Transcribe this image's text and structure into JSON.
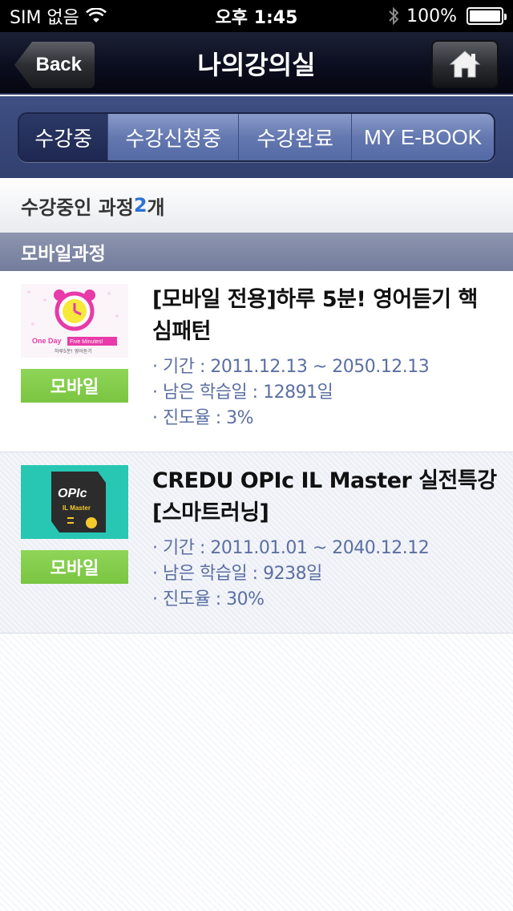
{
  "status_bar": {
    "carrier": "SIM 없음",
    "time": "오후 1:45",
    "battery": "100%"
  },
  "nav": {
    "back_label": "Back",
    "title": "나의강의실"
  },
  "tabs": [
    {
      "label": "수강중",
      "active": true
    },
    {
      "label": "수강신청중",
      "active": false
    },
    {
      "label": "수강완료",
      "active": false
    },
    {
      "label": "MY E-BOOK",
      "active": false
    }
  ],
  "summary": {
    "prefix": "수강중인 과정",
    "count": "2",
    "suffix": "개"
  },
  "section": {
    "title": "모바일과정"
  },
  "courses": [
    {
      "title": "[모바일 전용]하루 5분! 영어듣기 핵심패턴",
      "badge": "모바일",
      "thumb_text_1": "One Day",
      "thumb_text_2": "Five Minutes!",
      "thumb_text_3": "하루5분! 영어듣기",
      "period": "기간 : 2011.12.13 ~ 2050.12.13",
      "remaining": "남은 학습일 : 12891일",
      "progress": "진도율 : 3%"
    },
    {
      "title": "CREDU OPIc IL Master 실전특강[스마트러닝]",
      "badge": "모바일",
      "thumb_text_1": "OPIc",
      "thumb_text_2": "IL Master",
      "period": "기간 : 2011.01.01 ~ 2040.12.12",
      "remaining": "남은 학습일 : 9238일",
      "progress": "진도율 : 30%"
    }
  ],
  "colors": {
    "nav_bg": "#0b0e1f",
    "tab_band": "#3a4a7c",
    "tab_active": "#1e2852",
    "tab_inactive": "#6478b0",
    "count_accent": "#2a72d6",
    "section_bg": "#7d86a4",
    "badge_green": "#7ac541",
    "meta_text": "#5c6fa3"
  }
}
